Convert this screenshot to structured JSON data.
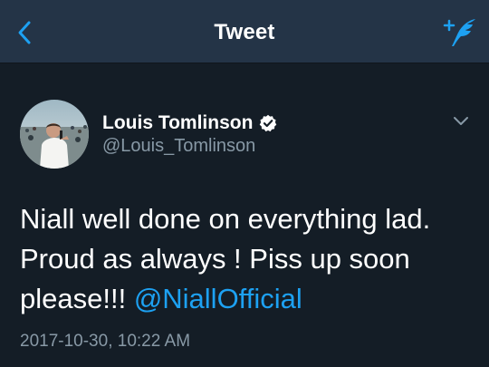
{
  "header": {
    "title": "Tweet",
    "back_icon": "chevron-left-icon",
    "compose_icon": "compose-tweet-icon",
    "accent_color": "#1da1f2"
  },
  "tweet": {
    "author": {
      "display_name": "Louis Tomlinson",
      "handle": "@Louis_Tomlinson",
      "verified": true
    },
    "text_lines": [
      "Niall well done on everything lad.",
      "Proud as always ! Piss up soon",
      "please!!! "
    ],
    "mention": "@NiallOfficial",
    "timestamp": "2017-10-30, 10:22 AM"
  },
  "colors": {
    "background": "#141d26",
    "navbar": "#243447",
    "secondary_text": "#8899a6",
    "link": "#1da1f2"
  }
}
